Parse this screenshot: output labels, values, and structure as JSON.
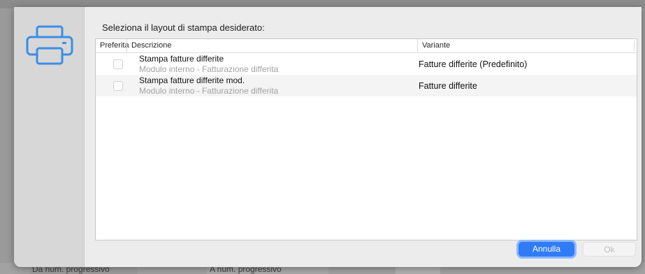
{
  "background": {
    "fields": [
      "Da num. progressivo",
      "A num. progressivo"
    ]
  },
  "dialog": {
    "icon": "printer-icon",
    "prompt": "Seleziona il layout di stampa desiderato:",
    "columns": {
      "preferred": "Preferita",
      "description": "Descrizione",
      "variant": "Variante"
    },
    "rows": [
      {
        "preferred": false,
        "title": "Stampa fatture differite",
        "subtitle": "Modulo interno - Fatturazione differita",
        "variant": "Fatture differite (Predefinito)"
      },
      {
        "preferred": false,
        "title": "Stampa fatture differite mod.",
        "subtitle": "Modulo interno - Fatturazione differita",
        "variant": "Fatture differite"
      }
    ],
    "buttons": {
      "cancel": "Annulla",
      "ok": "Ok"
    },
    "colors": {
      "accent": "#2f7cf6",
      "icon": "#3b8ee6"
    }
  }
}
